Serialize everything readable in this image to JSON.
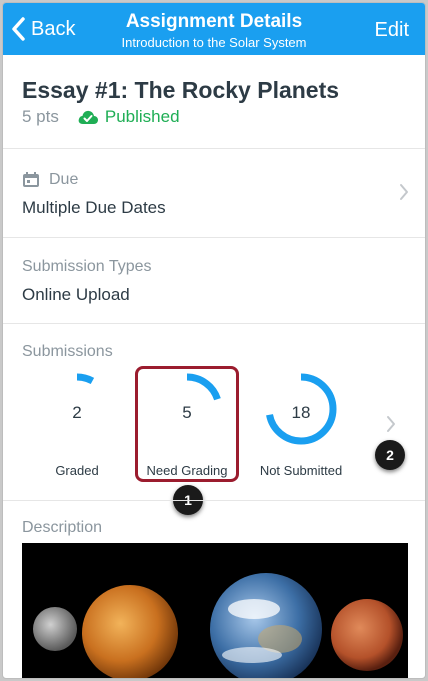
{
  "nav": {
    "back_label": "Back",
    "title": "Assignment Details",
    "subtitle": "Introduction to the Solar System",
    "edit_label": "Edit"
  },
  "assignment": {
    "title": "Essay #1: The Rocky Planets",
    "points": "5 pts",
    "status": "Published"
  },
  "due": {
    "label": "Due",
    "value": "Multiple Due Dates"
  },
  "submission_types": {
    "label": "Submission Types",
    "value": "Online Upload"
  },
  "submissions": {
    "label": "Submissions",
    "items": [
      {
        "count": "2",
        "caption": "Graded",
        "fraction": 0.08
      },
      {
        "count": "5",
        "caption": "Need Grading",
        "fraction": 0.2
      },
      {
        "count": "18",
        "caption": "Not Submitted",
        "fraction": 0.72
      }
    ]
  },
  "callouts": [
    "1",
    "2"
  ],
  "description": {
    "label": "Description"
  },
  "colors": {
    "nav_bar": "#1a9ff0",
    "published": "#1fae55",
    "ring": "#1a9ff0",
    "highlight": "#9b1c2e"
  }
}
